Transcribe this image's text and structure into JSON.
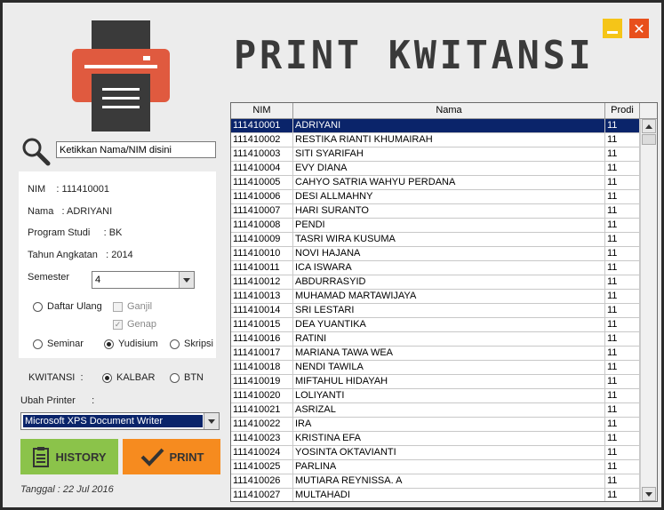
{
  "window": {
    "title": "PRINT KWITANSI"
  },
  "search": {
    "placeholder": "Ketikkan Nama/NIM disini"
  },
  "student": {
    "nim_label": "NIM    :",
    "nim": "111410001",
    "nama_label": "Nama   :",
    "nama": "ADRIYANI",
    "prodi_label": "Program Studi     :",
    "prodi": "BK",
    "angkatan_label": "Tahun Angkatan   :",
    "angkatan": "2014",
    "semester_label": "Semester",
    "semester": "4"
  },
  "options": {
    "daftar_ulang": "Daftar Ulang",
    "ganjil": "Ganjil",
    "genap": "Genap",
    "seminar": "Seminar",
    "yudisium": "Yudisium",
    "skripsi": "Skripsi"
  },
  "kwitansi": {
    "label": "KWITANSI  :",
    "kalbar": "KALBAR",
    "btn": "BTN"
  },
  "printer": {
    "label": "Ubah Printer      :",
    "selected": "Microsoft XPS Document Writer"
  },
  "buttons": {
    "history": "HISTORY",
    "print": "PRINT"
  },
  "footer": {
    "tanggal": "Tanggal : 22 Jul 2016"
  },
  "table": {
    "headers": [
      "NIM",
      "Nama",
      "Prodi"
    ],
    "rows": [
      [
        "111410001",
        "ADRIYANI",
        "11"
      ],
      [
        "111410002",
        "RESTIKA RIANTI KHUMAIRAH",
        "11"
      ],
      [
        "111410003",
        "SITI SYARIFAH",
        "11"
      ],
      [
        "111410004",
        "EVY DIANA",
        "11"
      ],
      [
        "111410005",
        "CAHYO SATRIA WAHYU PERDANA",
        "11"
      ],
      [
        "111410006",
        "DESI ALLMAHNY",
        "11"
      ],
      [
        "111410007",
        "HARI SURANTO",
        "11"
      ],
      [
        "111410008",
        "PENDI",
        "11"
      ],
      [
        "111410009",
        "TASRI WIRA KUSUMA",
        "11"
      ],
      [
        "111410010",
        "NOVI HAJANA",
        "11"
      ],
      [
        "111410011",
        "ICA ISWARA",
        "11"
      ],
      [
        "111410012",
        "ABDURRASYID",
        "11"
      ],
      [
        "111410013",
        "MUHAMAD MARTAWIJAYA",
        "11"
      ],
      [
        "111410014",
        "SRI LESTARI",
        "11"
      ],
      [
        "111410015",
        "DEA YUANTIKA",
        "11"
      ],
      [
        "111410016",
        "RATINI",
        "11"
      ],
      [
        "111410017",
        "MARIANA TAWA WEA",
        "11"
      ],
      [
        "111410018",
        "NENDI TAWILA",
        "11"
      ],
      [
        "111410019",
        "MIFTAHUL HIDAYAH",
        "11"
      ],
      [
        "111410020",
        "LOLIYANTI",
        "11"
      ],
      [
        "111410021",
        "ASRIZAL",
        "11"
      ],
      [
        "111410022",
        "IRA",
        "11"
      ],
      [
        "111410023",
        "KRISTINA EFA",
        "11"
      ],
      [
        "111410024",
        "YOSINTA OKTAVIANTI",
        "11"
      ],
      [
        "111410025",
        "PARLINA",
        "11"
      ],
      [
        "111410026",
        "MUTIARA REYNISSA. A",
        "11"
      ],
      [
        "111410027",
        "MULTAHADI",
        "11"
      ]
    ]
  }
}
